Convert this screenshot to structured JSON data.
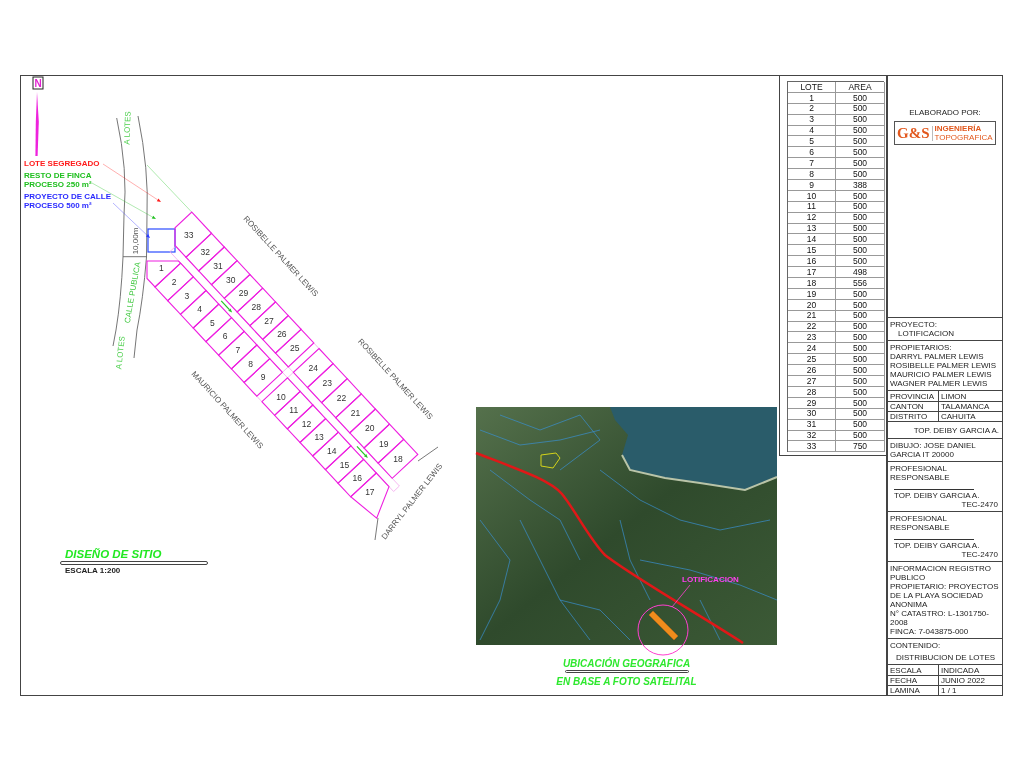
{
  "north_arrow": {
    "label": "N"
  },
  "legend": [
    {
      "lines": [
        "LOTE SEGREGADO"
      ],
      "color": "#ff1a1a"
    },
    {
      "lines": [
        "RESTO DE FINCA",
        "PROCESO 250 m²"
      ],
      "color": "#1fbf1f"
    },
    {
      "lines": [
        "PROYECTO DE CALLE",
        "PROCESO 500 m²"
      ],
      "color": "#2a2aff"
    }
  ],
  "road": {
    "direction_labels": [
      "A LOTES",
      "A LOTES"
    ],
    "name": "CALLE PUBLICA",
    "width_label": "10,00m"
  },
  "lots": [
    {
      "number": "1"
    },
    {
      "number": "2"
    },
    {
      "number": "3"
    },
    {
      "number": "4"
    },
    {
      "number": "5"
    },
    {
      "number": "6"
    },
    {
      "number": "7"
    },
    {
      "number": "8"
    },
    {
      "number": "9"
    },
    {
      "number": "10"
    },
    {
      "number": "11"
    },
    {
      "number": "12"
    },
    {
      "number": "13"
    },
    {
      "number": "14"
    },
    {
      "number": "15"
    },
    {
      "number": "16"
    },
    {
      "number": "17"
    },
    {
      "number": "18"
    },
    {
      "number": "19"
    },
    {
      "number": "20"
    },
    {
      "number": "21"
    },
    {
      "number": "22"
    },
    {
      "number": "23"
    },
    {
      "number": "24"
    },
    {
      "number": "25"
    },
    {
      "number": "26"
    },
    {
      "number": "27"
    },
    {
      "number": "28"
    },
    {
      "number": "29"
    },
    {
      "number": "30"
    },
    {
      "number": "31"
    },
    {
      "number": "32"
    },
    {
      "number": "33"
    }
  ],
  "neighbors": [
    {
      "name": "ROSIBELLE PALMER LEWIS"
    },
    {
      "name": "ROSIBELLE PALMER LEWIS"
    },
    {
      "name": "MAURICIO PALMER LEWIS"
    },
    {
      "name": "DARRYL PALMER LEWIS"
    }
  ],
  "site_plan": {
    "title": "DISEÑO DE SITIO",
    "scale": "ESCALA 1:200"
  },
  "location_map": {
    "annotation": "LOTIFICACION",
    "title": "UBICACIÓN GEOGRAFICA",
    "subtitle": "EN BASE A FOTO SATELITAL"
  },
  "area_table": {
    "columns": [
      "LOTE",
      "AREA"
    ],
    "rows": [
      [
        "1",
        "500"
      ],
      [
        "2",
        "500"
      ],
      [
        "3",
        "500"
      ],
      [
        "4",
        "500"
      ],
      [
        "5",
        "500"
      ],
      [
        "6",
        "500"
      ],
      [
        "7",
        "500"
      ],
      [
        "8",
        "500"
      ],
      [
        "9",
        "388"
      ],
      [
        "10",
        "500"
      ],
      [
        "11",
        "500"
      ],
      [
        "12",
        "500"
      ],
      [
        "13",
        "500"
      ],
      [
        "14",
        "500"
      ],
      [
        "15",
        "500"
      ],
      [
        "16",
        "500"
      ],
      [
        "17",
        "498"
      ],
      [
        "18",
        "556"
      ],
      [
        "19",
        "500"
      ],
      [
        "20",
        "500"
      ],
      [
        "21",
        "500"
      ],
      [
        "22",
        "500"
      ],
      [
        "23",
        "500"
      ],
      [
        "24",
        "500"
      ],
      [
        "25",
        "500"
      ],
      [
        "26",
        "500"
      ],
      [
        "27",
        "500"
      ],
      [
        "28",
        "500"
      ],
      [
        "29",
        "500"
      ],
      [
        "30",
        "500"
      ],
      [
        "31",
        "500"
      ],
      [
        "32",
        "500"
      ],
      [
        "33",
        "750"
      ]
    ]
  },
  "title_block": {
    "prepared_by_label": "ELABORADO POR:",
    "logo": {
      "initials": "G&S",
      "line_1": "INGENIERÍA",
      "line_2": "TOPOGRAFICA"
    },
    "project_label": "PROYECTO:",
    "project": "LOTIFICACION",
    "owners_label": "PROPIETARIOS:",
    "owners": [
      "DARRYL PALMER LEWIS",
      "ROSIBELLE PALMER LEWIS",
      "MAURICIO PALMER LEWIS",
      "WAGNER PALMER LEWIS"
    ],
    "location": {
      "columns": [
        "PROVINCIA",
        "CANTON",
        "DISTRITO"
      ],
      "values": [
        "LIMON",
        "TALAMANCA",
        "CAHUITA"
      ]
    },
    "surveyor": "TOP. DEIBY GARCIA A.",
    "drawing_by": "DIBUJO: JOSE DANIEL GARCIA IT 20000",
    "professionals": [
      {
        "label": "PROFESIONAL RESPONSABLE",
        "name": "TOP. DEIBY GARCIA A.",
        "code": "TEC-2470"
      },
      {
        "label": "PROFESIONAL RESPONSABLE",
        "name": "TOP. DEIBY GARCIA A.",
        "code": "TEC-2470"
      }
    ],
    "registry": [
      "INFORMACION REGISTRO PUBLICO",
      "PROPIETARIO: PROYECTOS DE LA PLAYA SOCIEDAD ANONIMA",
      "N° CATASTRO: L-1301750-2008",
      "FINCA: 7-043875-000"
    ],
    "contents_label": "CONTENIDO:",
    "contents": "DISTRIBUCION DE LOTES",
    "footer": {
      "columns": [
        "ESCALA",
        "FECHA",
        "LAMINA"
      ],
      "values": [
        "INDICADA",
        "JUNIO 2022",
        "1 / 1"
      ]
    }
  }
}
